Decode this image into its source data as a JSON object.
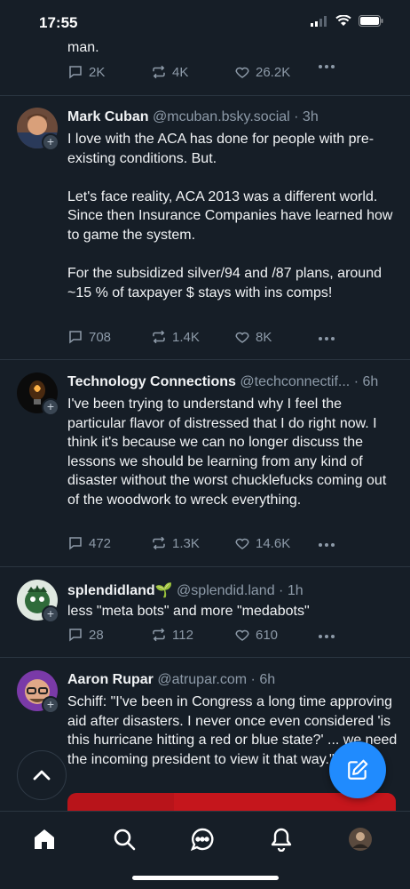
{
  "status_bar": {
    "time": "17:55"
  },
  "feed": {
    "top_fragment": {
      "text": "man.",
      "replies": "2K",
      "reposts": "4K",
      "likes": "26.2K"
    },
    "posts": [
      {
        "name": "Mark Cuban",
        "handle": "@mcuban.bsky.social",
        "time": "· 3h",
        "text": "I love with the ACA has done for people with pre-existing conditions.  But.\n\nLet's face reality, ACA 2013 was a different world.  Since then Insurance Companies have learned how to game the system.\n\nFor the subsidized silver/94 and /87 plans, around ~15 % of taxpayer $  stays with ins comps!",
        "replies": "708",
        "reposts": "1.4K",
        "likes": "8K"
      },
      {
        "name": "Technology Connections",
        "handle": "@techconnectif...",
        "time": "· 6h",
        "text": "I've been trying to understand why I feel the particular flavor of distressed that I do right now. I think it's because we can no longer discuss the lessons we should be learning from any kind of disaster without the worst chucklefucks coming out of the woodwork to wreck everything.",
        "replies": "472",
        "reposts": "1.3K",
        "likes": "14.6K"
      },
      {
        "name": "splendidland🌱",
        "handle": "@splendid.land",
        "time": "· 1h",
        "text": "less \"meta bots\" and more \"medabots\"",
        "replies": "28",
        "reposts": "112",
        "likes": "610"
      },
      {
        "name": "Aaron Rupar",
        "handle": "@atrupar.com",
        "time": "· 6h",
        "text": "Schiff: \"I've been in Congress a long time approving aid after disasters. I never once even considered 'is this hurricane hitting a red or blue state?' ... we need the incoming president to view it that way.\""
      }
    ]
  },
  "colors": {
    "background": "#161e27",
    "accent": "#208bfe",
    "muted": "#8d9aa8"
  },
  "icons": {
    "fab": "compose-icon",
    "scroll_top": "chevron-up-icon",
    "tabs": [
      "home-icon",
      "search-icon",
      "chat-icon",
      "bell-icon",
      "profile-avatar"
    ]
  }
}
